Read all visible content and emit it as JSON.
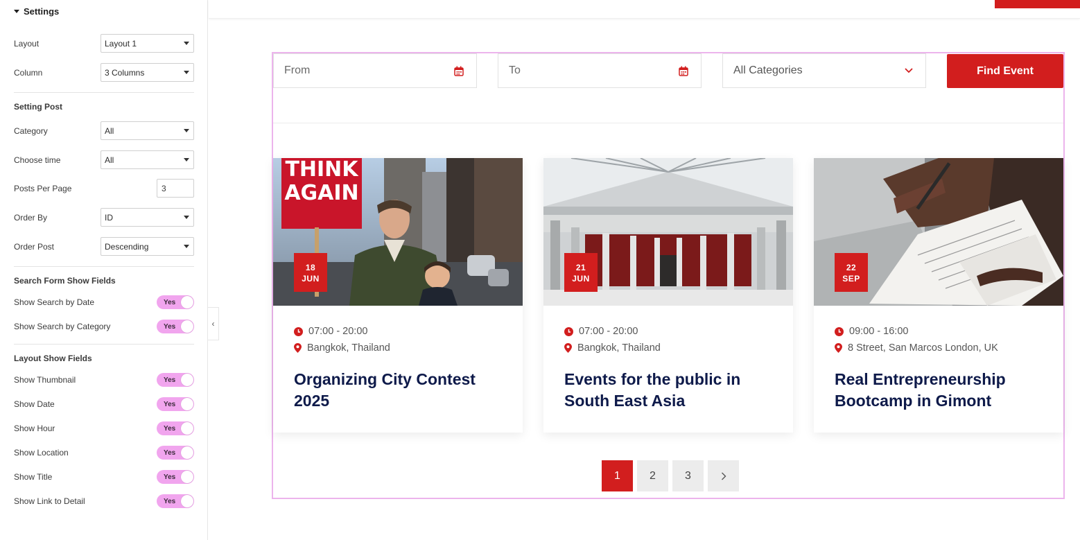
{
  "sidebar": {
    "heading": "Settings",
    "layout": {
      "label": "Layout",
      "value": "Layout 1"
    },
    "column": {
      "label": "Column",
      "value": "3 Columns"
    },
    "setting_post_title": "Setting Post",
    "category": {
      "label": "Category",
      "value": "All"
    },
    "choose_time": {
      "label": "Choose time",
      "value": "All"
    },
    "posts_per_page": {
      "label": "Posts Per Page",
      "value": "3"
    },
    "order_by": {
      "label": "Order By",
      "value": "ID"
    },
    "order_post": {
      "label": "Order Post",
      "value": "Descending"
    },
    "search_fields_title": "Search Form Show Fields",
    "search_toggles": [
      {
        "label": "Show Search by Date",
        "value": "Yes"
      },
      {
        "label": "Show Search by Category",
        "value": "Yes"
      }
    ],
    "layout_fields_title": "Layout Show Fields",
    "layout_toggles": [
      {
        "label": "Show Thumbnail",
        "value": "Yes"
      },
      {
        "label": "Show Date",
        "value": "Yes"
      },
      {
        "label": "Show Hour",
        "value": "Yes"
      },
      {
        "label": "Show Location",
        "value": "Yes"
      },
      {
        "label": "Show Title",
        "value": "Yes"
      },
      {
        "label": "Show Link to Detail",
        "value": "Yes"
      }
    ]
  },
  "search": {
    "from_placeholder": "From",
    "to_placeholder": "To",
    "category_value": "All Categories",
    "find_label": "Find Event"
  },
  "events": [
    {
      "day": "18",
      "month": "JUN",
      "time": "07:00 - 20:00",
      "location": "Bangkok, Thailand",
      "title": "Organizing City Contest 2025"
    },
    {
      "day": "21",
      "month": "JUN",
      "time": "07:00 - 20:00",
      "location": "Bangkok, Thailand",
      "title": "Events for the public in South East Asia"
    },
    {
      "day": "22",
      "month": "SEP",
      "time": "09:00 - 16:00",
      "location": "8 Street, San Marcos London, UK",
      "title": "Real Entrepreneurship Bootcamp in Gimont"
    }
  ],
  "photo_text": {
    "sign": "THINK AGAIN"
  },
  "pagination": {
    "pages": [
      "1",
      "2",
      "3"
    ],
    "current": "1",
    "next_icon": "chevron-right-icon"
  },
  "colors": {
    "accent": "#d21e1e",
    "toggle": "#f1a5ee",
    "title": "#0e1a4a",
    "frame": "#ecb4ec"
  }
}
